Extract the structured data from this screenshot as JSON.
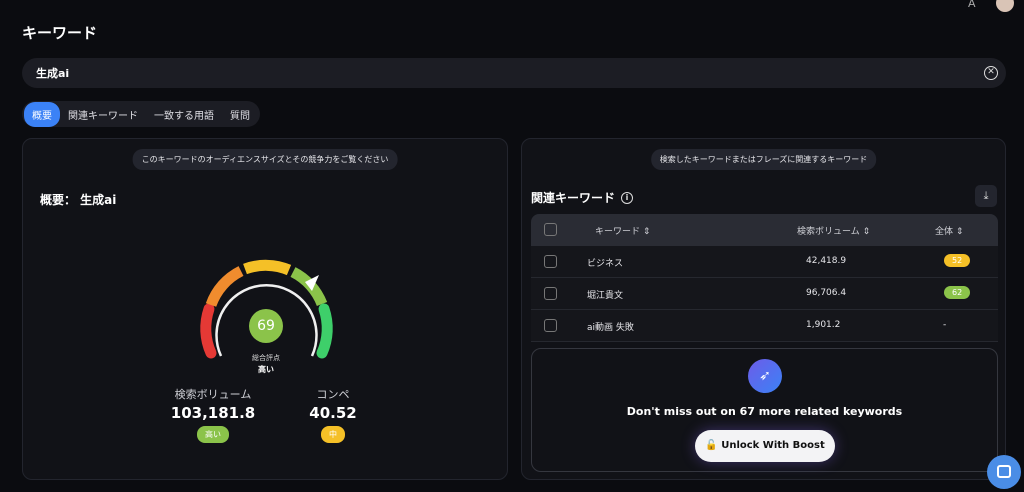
{
  "page": {
    "title": "キーワード"
  },
  "search": {
    "value": "生成ai",
    "clear_icon": "close-circle-icon"
  },
  "tabs": [
    {
      "label": "概要",
      "active": true
    },
    {
      "label": "関連キーワード",
      "active": false
    },
    {
      "label": "一致する用語",
      "active": false
    },
    {
      "label": "質問",
      "active": false
    }
  ],
  "overview": {
    "pill": "このキーワードのオーディエンスサイズとその競争力をご覧ください",
    "title": "概要： 生成ai",
    "score": "69",
    "score_label": "総合評点",
    "score_value": "高い",
    "gauge_level": 0.69,
    "volume_label": "検索ボリューム",
    "volume_value": "103,181.8",
    "volume_badge": "高い",
    "competition_label": "コンペ",
    "competition_value": "40.52",
    "competition_badge": "中"
  },
  "related": {
    "pill": "検索したキーワードまたはフレーズに関連するキーワード",
    "title": "関連キーワード",
    "headers": {
      "keyword": "キーワード",
      "volume": "検索ボリューム",
      "overall": "全体"
    },
    "rows": [
      {
        "keyword": "ビジネス",
        "volume": "42,418.9",
        "score": "52",
        "color": "#f5c027"
      },
      {
        "keyword": "堀江貴文",
        "volume": "96,706.4",
        "score": "62",
        "color": "#8bc34a"
      },
      {
        "keyword": "ai動画 失敗",
        "volume": "1,901.2",
        "score": "-",
        "color": ""
      }
    ],
    "boost_text": "Don't miss out on 67 more related keywords",
    "unlock_label": "Unlock With Boost"
  },
  "colors": {
    "accent": "#3b82f6",
    "green": "#8bc34a",
    "yellow": "#f5c027",
    "red": "#e53935"
  }
}
